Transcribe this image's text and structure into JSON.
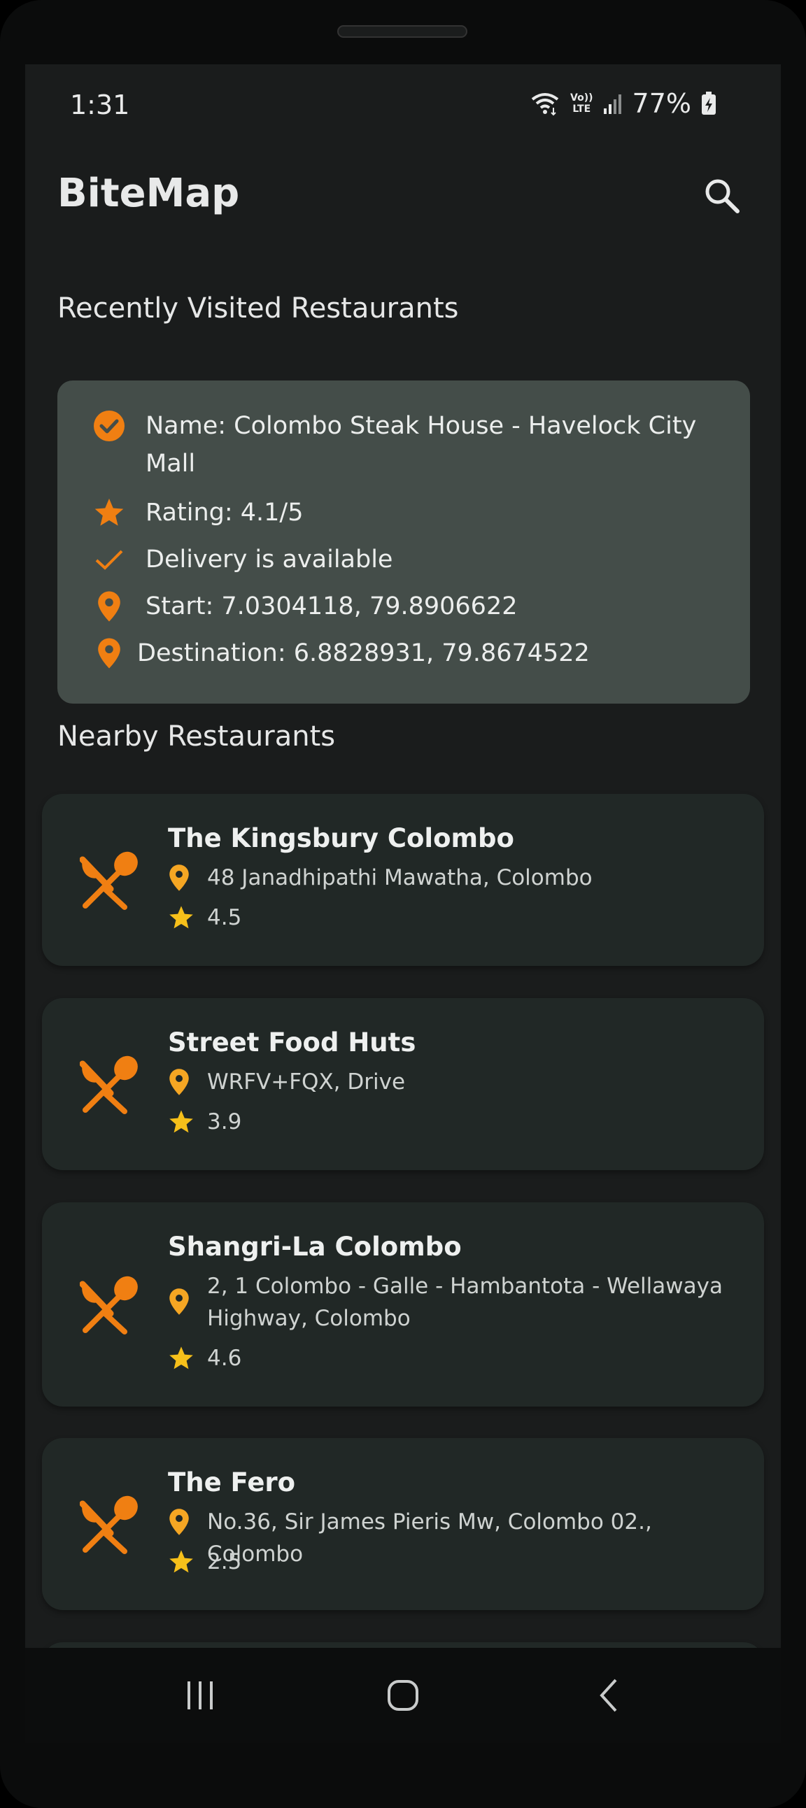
{
  "status_bar": {
    "time": "1:31",
    "lte_top": "Vo))",
    "lte_bottom": "LTE",
    "battery": "77%"
  },
  "app_bar": {
    "title": "BiteMap",
    "search_icon": "search-icon"
  },
  "recent": {
    "section_title": "Recently Visited Restaurants",
    "name": "Name: Colombo Steak House - Havelock City Mall",
    "rating": "Rating: 4.1/5",
    "delivery": "Delivery is available",
    "start": "Start: 7.0304118, 79.8906622",
    "destination": "Destination: 6.8828931, 79.8674522"
  },
  "nearby": {
    "section_title": "Nearby Restaurants",
    "items": [
      {
        "name": "The Kingsbury Colombo",
        "address": "48 Janadhipathi Mawatha, Colombo",
        "rating": "4.5"
      },
      {
        "name": "Street Food Huts",
        "address": "WRFV+FQX, Drive",
        "rating": "3.9"
      },
      {
        "name": "Shangri-La Colombo",
        "address": "2, 1 Colombo - Galle - Hambantota - Wellawaya Highway, Colombo",
        "rating": "4.6"
      },
      {
        "name": "The Fero",
        "address": "No.36, Sir James Pieris Mw, Colombo 02., Colombo",
        "rating": "2.5"
      }
    ]
  },
  "colors": {
    "accent": "#f07f12",
    "star": "#f6c01a",
    "card": "#212826",
    "recent_card": "#444d49"
  },
  "icons": {
    "restaurant": "fork-spoon-icon",
    "pin": "location-pin-icon",
    "star": "star-icon",
    "check_circle": "check-circle-icon",
    "check": "check-icon",
    "nav_recents": "recents-icon",
    "nav_home": "home-icon",
    "nav_back": "back-icon"
  }
}
